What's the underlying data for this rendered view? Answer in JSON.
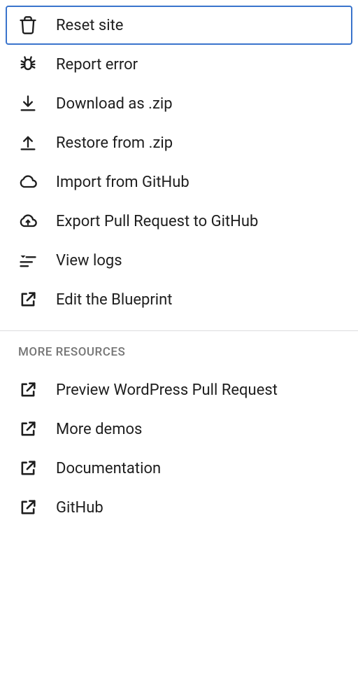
{
  "menu": {
    "items": [
      {
        "icon": "trash-icon",
        "label": "Reset site",
        "focused": true
      },
      {
        "icon": "bug-icon",
        "label": "Report error"
      },
      {
        "icon": "download-icon",
        "label": "Download as .zip"
      },
      {
        "icon": "upload-icon",
        "label": "Restore from .zip"
      },
      {
        "icon": "cloud-icon",
        "label": "Import from GitHub"
      },
      {
        "icon": "cloud-upload-icon",
        "label": "Export Pull Request to GitHub"
      },
      {
        "icon": "logs-icon",
        "label": "View logs"
      },
      {
        "icon": "external-icon",
        "label": "Edit the Blueprint"
      }
    ]
  },
  "resources": {
    "header": "More Resources",
    "items": [
      {
        "icon": "external-icon",
        "label": "Preview WordPress Pull Request"
      },
      {
        "icon": "external-icon",
        "label": "More demos"
      },
      {
        "icon": "external-icon",
        "label": "Documentation"
      },
      {
        "icon": "external-icon",
        "label": "GitHub"
      }
    ]
  }
}
